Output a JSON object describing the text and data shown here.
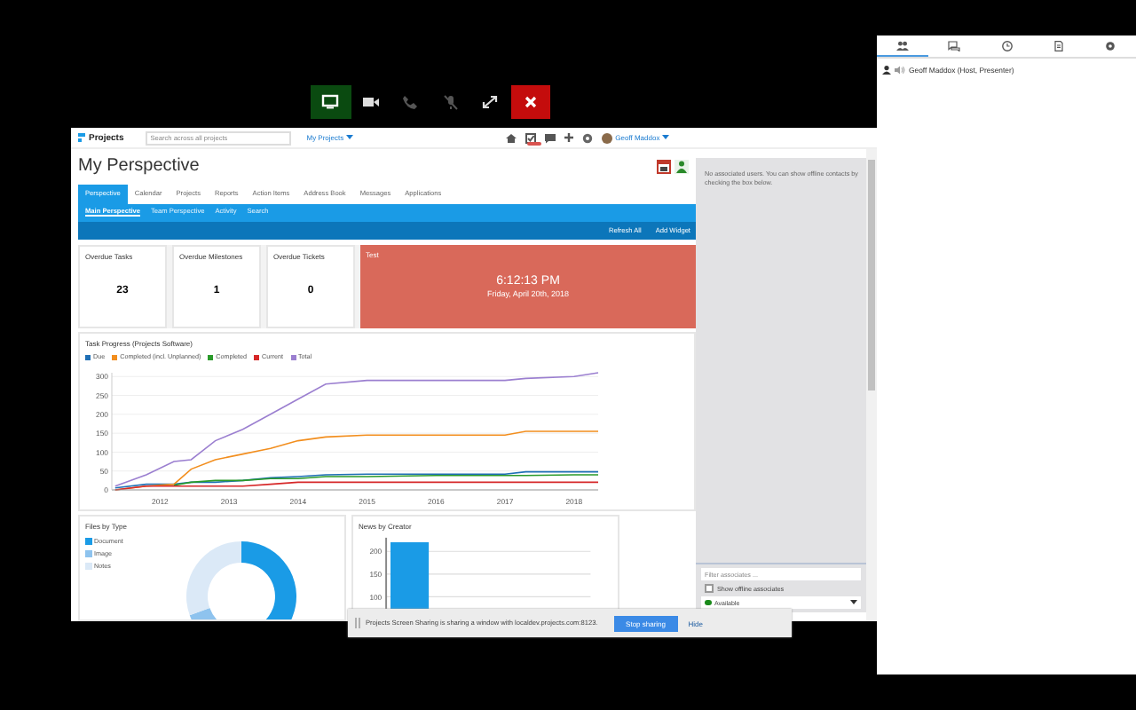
{
  "call_toolbar": {
    "buttons": [
      {
        "kind": "screen",
        "on": true,
        "disabled": false
      },
      {
        "kind": "camera",
        "on": false,
        "disabled": false
      },
      {
        "kind": "phone",
        "on": false,
        "disabled": true
      },
      {
        "kind": "mic",
        "on": false,
        "disabled": true
      },
      {
        "kind": "expand",
        "on": false,
        "disabled": false
      },
      {
        "kind": "close",
        "on": false,
        "disabled": false
      }
    ]
  },
  "shared_window": {
    "nav": {
      "logo": "Projects",
      "search_placeholder": "Search across all projects",
      "projects_menu": "My Projects",
      "user": "Geoff Maddox"
    },
    "page_title": "My Perspective",
    "tabs": [
      {
        "label": "Perspective",
        "selected": true
      },
      {
        "label": "Calendar",
        "selected": false
      },
      {
        "label": "Projects",
        "selected": false
      },
      {
        "label": "Reports",
        "selected": false
      },
      {
        "label": "Action Items",
        "selected": false
      },
      {
        "label": "Address Book",
        "selected": false
      },
      {
        "label": "Messages",
        "selected": false
      },
      {
        "label": "Applications",
        "selected": false
      }
    ],
    "subtabs": [
      {
        "label": "Main Perspective",
        "selected": true
      },
      {
        "label": "Team Perspective",
        "selected": false
      },
      {
        "label": "Activity",
        "selected": false
      },
      {
        "label": "Search",
        "selected": false
      }
    ],
    "actions": [
      "Refresh All",
      "Add Widget"
    ],
    "stat_cards": [
      {
        "title": "Overdue Tasks",
        "value": "23"
      },
      {
        "title": "Overdue Milestones",
        "value": "1"
      },
      {
        "title": "Overdue Tickets",
        "value": "0"
      }
    ],
    "clock_card": {
      "title": "Test",
      "time": "6:12:13 PM",
      "date": "Friday, April 20th, 2018"
    },
    "task_progress": {
      "chart_data": {
        "type": "line",
        "title": "Task Progress (Projects Software)",
        "x": [
          2011.35,
          2011.8,
          2012.2,
          2012.45,
          2012.8,
          2013.2,
          2013.6,
          2014.0,
          2014.4,
          2015.0,
          2016.0,
          2017.0,
          2017.3,
          2018.0,
          2018.35
        ],
        "series": [
          {
            "name": "Due",
            "color": "#1f6fb5",
            "values": [
              5,
              15,
              15,
              20,
              20,
              25,
              32,
              35,
              40,
              42,
              42,
              42,
              48,
              48,
              48
            ]
          },
          {
            "name": "Completed (incl. Unplanned)",
            "color": "#f28e1e",
            "values": [
              0,
              10,
              15,
              55,
              80,
              95,
              110,
              130,
              140,
              145,
              145,
              145,
              155,
              155,
              155
            ]
          },
          {
            "name": "Completed",
            "color": "#2a9a2a",
            "values": [
              null,
              null,
              12,
              20,
              25,
              25,
              30,
              30,
              35,
              35,
              38,
              38,
              38,
              40,
              40
            ]
          },
          {
            "name": "Current",
            "color": "#d62728",
            "values": [
              0,
              10,
              10,
              10,
              10,
              10,
              15,
              20,
              20,
              20,
              20,
              20,
              20,
              20,
              20
            ]
          },
          {
            "name": "Total",
            "color": "#9b7fd0",
            "values": [
              10,
              40,
              75,
              80,
              130,
              160,
              200,
              240,
              280,
              290,
              290,
              290,
              295,
              300,
              310
            ]
          }
        ],
        "xlim": [
          2011.3,
          2018.35
        ],
        "ylim": [
          0,
          310
        ],
        "xticks": [
          2012,
          2013,
          2014,
          2015,
          2016,
          2017,
          2018
        ],
        "yticks": [
          0,
          50,
          100,
          150,
          200,
          250,
          300
        ],
        "grid": true
      }
    },
    "files_by_type": {
      "title": "Files by Type",
      "legend": [
        {
          "label": "Document",
          "color": "#1a9be6"
        },
        {
          "label": "Image",
          "color": "#8ec3ee"
        },
        {
          "label": "Notes",
          "color": "#dbe9f7"
        }
      ]
    },
    "news_by_creator": {
      "title": "News by Creator",
      "chart_data": {
        "type": "bar",
        "values": [
          220
        ],
        "color": "#1a9be6",
        "ylim": [
          50,
          230
        ],
        "yticks": [
          100,
          150,
          200
        ],
        "grid": true
      }
    },
    "contacts_panel": {
      "message": "No associated users. You can show offline contacts by checking the box below.",
      "filter_placeholder": "Filter associates ...",
      "show_offline": {
        "label": "Show offline associates",
        "checked": false
      },
      "status": {
        "label": "Available",
        "color": "#1a8a1a"
      }
    }
  },
  "share_notice": {
    "message": "Projects Screen Sharing is sharing a window with localdev.projects.com:8123.",
    "stop_button": "Stop sharing",
    "hide_link": "Hide"
  },
  "side_panel": {
    "tabs": [
      {
        "kind": "people",
        "selected": true
      },
      {
        "kind": "chat",
        "selected": false
      },
      {
        "kind": "clock",
        "selected": false
      },
      {
        "kind": "document",
        "selected": false
      },
      {
        "kind": "settings",
        "selected": false
      }
    ],
    "participants": [
      {
        "name": "Geoff Maddox (Host, Presenter)"
      }
    ]
  }
}
